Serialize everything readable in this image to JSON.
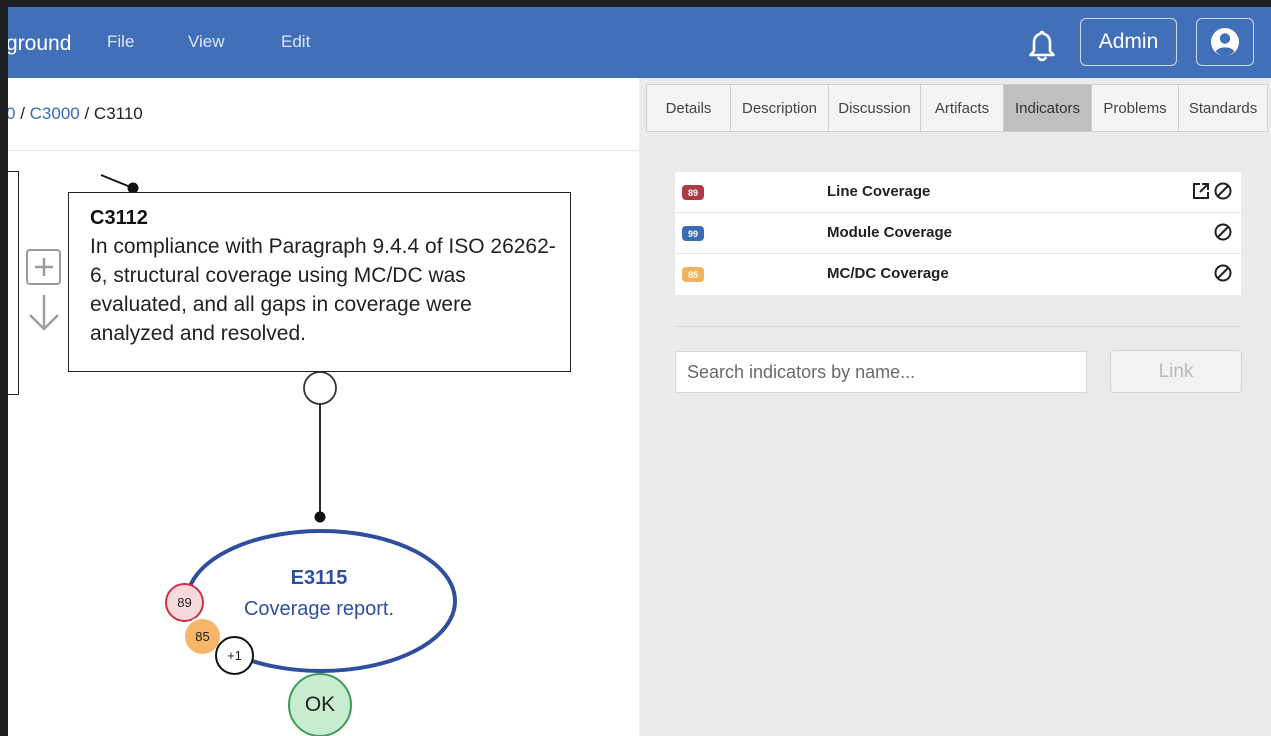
{
  "header": {
    "app_title": "ground",
    "menu": [
      {
        "label": "File"
      },
      {
        "label": "View"
      },
      {
        "label": "Edit"
      }
    ],
    "admin_label": "Admin",
    "icons": {
      "notifications": "bell-icon",
      "account": "user-circle-icon"
    }
  },
  "breadcrumb": {
    "prefix": "0",
    "separator": " / ",
    "parent": "C3000",
    "current": "C3110"
  },
  "canvas": {
    "claim": {
      "id": "C3112",
      "text": "In compliance with Paragraph 9.4.4 of ISO 26262-6, structural coverage using MC/DC was evaluated, and all gaps in coverage were analyzed and resolved."
    },
    "evidence": {
      "id": "E3115",
      "text": "Coverage report."
    },
    "badges": [
      {
        "value": "89",
        "color": "#cc3344"
      },
      {
        "value": "85",
        "color": "#f7b56a"
      },
      {
        "value": "+1",
        "color": "#ffffff"
      }
    ],
    "status": "OK",
    "icons": {
      "expand": "plus-square-icon",
      "down": "arrow-down-icon"
    }
  },
  "tabs": [
    {
      "label": "Details",
      "active": false
    },
    {
      "label": "Description",
      "active": false
    },
    {
      "label": "Discussion",
      "active": false
    },
    {
      "label": "Artifacts",
      "active": false
    },
    {
      "label": "Indicators",
      "active": true
    },
    {
      "label": "Problems",
      "active": false
    },
    {
      "label": "Standards",
      "active": false
    }
  ],
  "indicators": [
    {
      "score": "89",
      "color": "#b03a44",
      "name": "Line Coverage",
      "actions": [
        "external-link-icon",
        "ban-icon"
      ]
    },
    {
      "score": "99",
      "color": "#3a6cb5",
      "name": "Module Coverage",
      "actions": [
        "ban-icon"
      ]
    },
    {
      "score": "85",
      "color": "#f2b35c",
      "name": "MC/DC Coverage",
      "actions": [
        "ban-icon"
      ]
    }
  ],
  "search": {
    "placeholder": "Search indicators by name...",
    "value": ""
  },
  "link_button": "Link",
  "colors": {
    "header_bg": "#4270b8",
    "evidence_blue": "#2f4f9e",
    "panel_bg": "#ebebeb",
    "ok_green": "#3e9a57"
  }
}
